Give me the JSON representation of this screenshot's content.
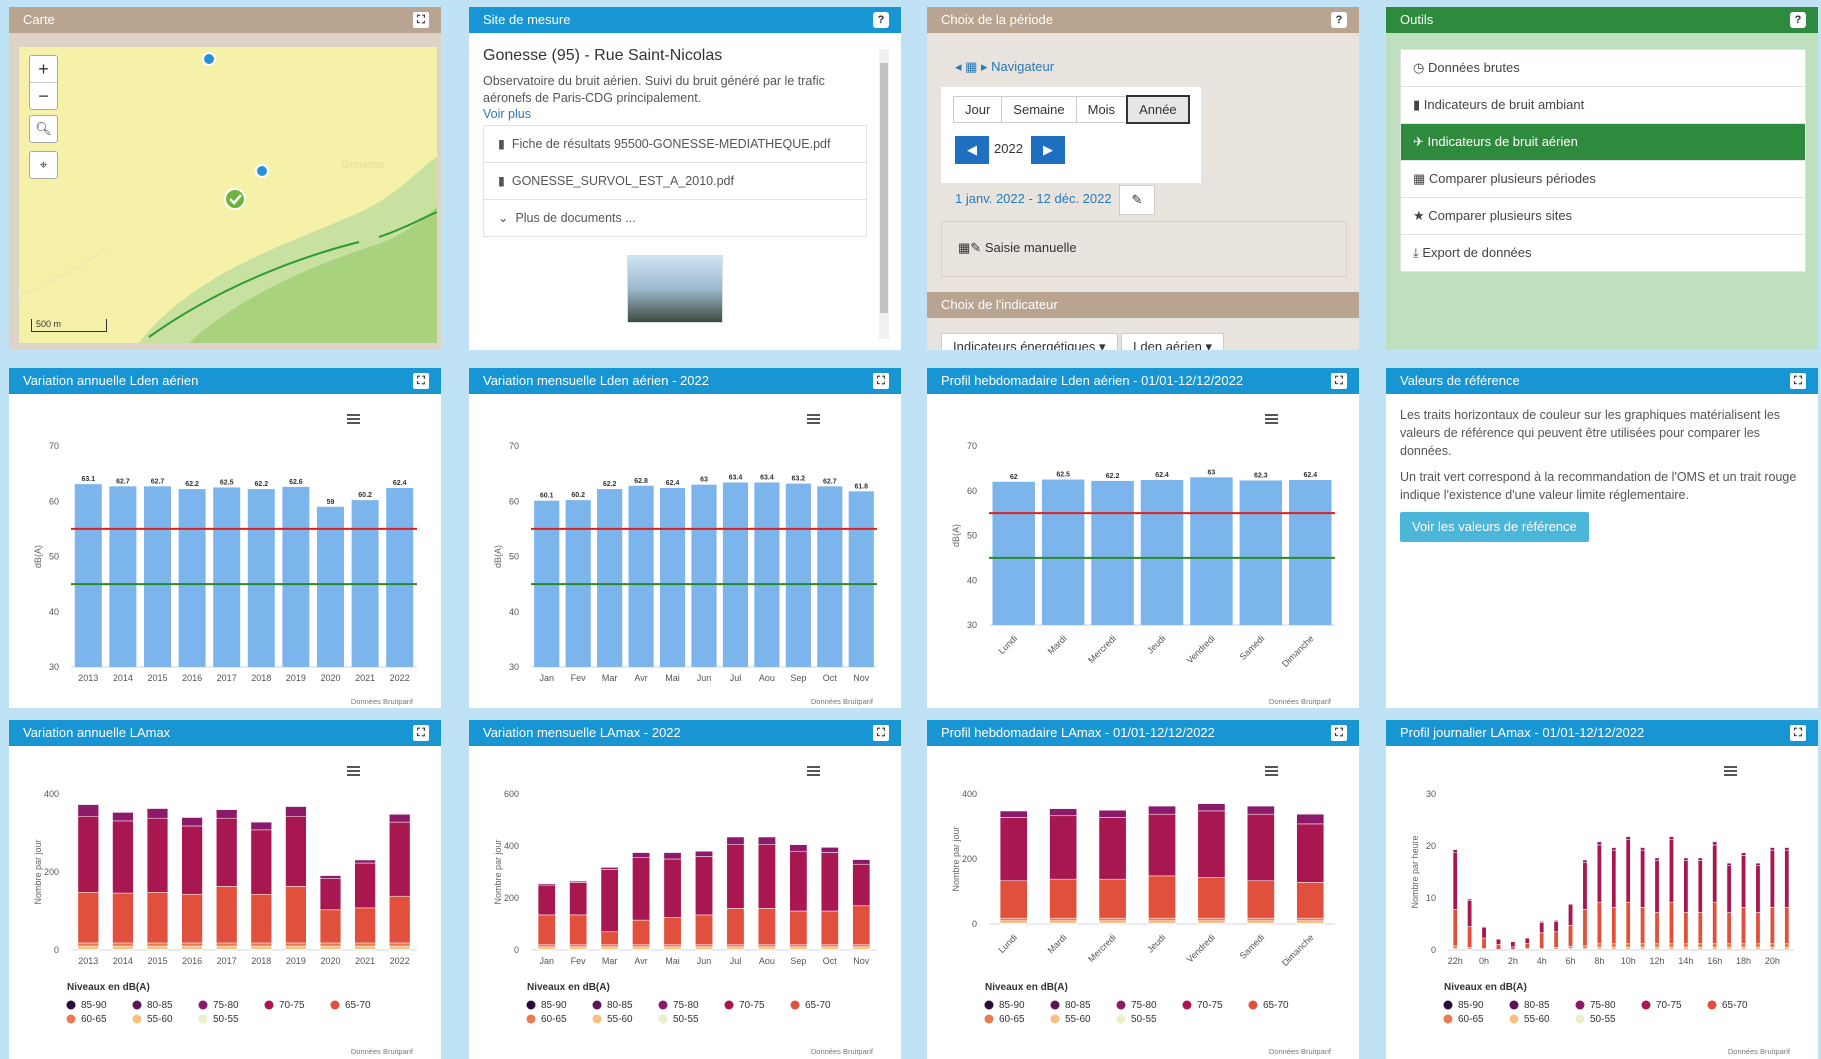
{
  "carte": {
    "title": "Carte",
    "zoom_in": "+",
    "zoom_out": "−",
    "scale": "500 m",
    "place": "Gonesse"
  },
  "site": {
    "title": "Site de mesure",
    "name": "Gonesse (95) - Rue Saint-Nicolas",
    "desc": "Observatoire du bruit aérien. Suivi du bruit généré par le trafic aéronefs de Paris-CDG principalement.",
    "more": "Voir plus",
    "docs": [
      "Fiche de résultats 95500-GONESSE-MEDIATHEQUE.pdf",
      "GONESSE_SURVOL_EST_A_2010.pdf",
      "Plus de documents ..."
    ]
  },
  "periode": {
    "title": "Choix de la période",
    "nav": "Navigateur",
    "tabs": [
      "Jour",
      "Semaine",
      "Mois",
      "Année"
    ],
    "year": "2022",
    "range": "1 janv. 2022 - 12 déc. 2022",
    "manual": "Saisie manuelle"
  },
  "indicateur": {
    "title": "Choix de l'indicateur",
    "d1": "Indicateurs énergétiques",
    "d2": "Lden aérien"
  },
  "outils": {
    "title": "Outils",
    "items": [
      "Données brutes",
      "Indicateurs de bruit ambiant",
      "Indicateurs de bruit aérien",
      "Comparer plusieurs périodes",
      "Comparer plusieurs sites",
      "Export de données"
    ]
  },
  "ref": {
    "title": "Valeurs de référence",
    "p1": "Les traits horizontaux de couleur sur les graphiques matérialisent les valeurs de référence qui peuvent être utilisées pour comparer les données.",
    "p2": "Un trait vert correspond à la recommandation de l'OMS et un trait rouge indique l'existence d'une valeur limite réglementaire.",
    "button": "Voir les valeurs de référence"
  },
  "credit": "Données Bruitparif",
  "legend": {
    "title": "Niveaux en dB(A)",
    "items": [
      "85-90",
      "80-85",
      "75-80",
      "70-75",
      "65-70",
      "60-65",
      "55-60",
      "50-55"
    ],
    "colors": [
      "#2b0a3d",
      "#5b1557",
      "#8c1a6a",
      "#a8174f",
      "#e0503c",
      "#ea7a4f",
      "#f5c17f",
      "#e8f0c8"
    ]
  },
  "chart_data": [
    {
      "id": "c1",
      "title": "Variation annuelle Lden aérien",
      "type": "bar",
      "ylabel": "dB(A)",
      "ylim": [
        30,
        70
      ],
      "yticks": [
        30,
        40,
        50,
        60,
        70
      ],
      "categories": [
        "2013",
        "2014",
        "2015",
        "2016",
        "2017",
        "2018",
        "2019",
        "2020",
        "2021",
        "2022"
      ],
      "values": [
        63.1,
        62.7,
        62.7,
        62.2,
        62.5,
        62.2,
        62.6,
        59,
        60.2,
        62.4
      ],
      "labels": [
        "63.1",
        "62.7",
        "62.7",
        "62.2",
        "62.5",
        "62.2",
        "62.6",
        "59",
        "60.2",
        "62.4"
      ],
      "ref_lines": [
        {
          "value": 55,
          "color": "#e02020"
        },
        {
          "value": 45,
          "color": "#2a8a2a"
        }
      ]
    },
    {
      "id": "c2",
      "title": "Variation mensuelle Lden aérien - 2022",
      "type": "bar",
      "ylabel": "dB(A)",
      "ylim": [
        30,
        70
      ],
      "yticks": [
        30,
        40,
        50,
        60,
        70
      ],
      "categories": [
        "Jan",
        "Fev",
        "Mar",
        "Avr",
        "Mai",
        "Jun",
        "Jul",
        "Aou",
        "Sep",
        "Oct",
        "Nov"
      ],
      "values": [
        60.1,
        60.2,
        62.2,
        62.8,
        62.4,
        63,
        63.4,
        63.4,
        63.2,
        62.7,
        61.8
      ],
      "labels": [
        "60.1",
        "60.2",
        "62.2",
        "62.8",
        "62.4",
        "63",
        "63.4",
        "63.4",
        "63.2",
        "62.7",
        "61.8"
      ],
      "ref_lines": [
        {
          "value": 55,
          "color": "#e02020"
        },
        {
          "value": 45,
          "color": "#2a8a2a"
        }
      ]
    },
    {
      "id": "c3",
      "title": "Profil hebdomadaire Lden aérien - 01/01-12/12/2022",
      "type": "bar",
      "ylabel": "dB(A)",
      "ylim": [
        30,
        70
      ],
      "yticks": [
        30,
        40,
        50,
        60,
        70
      ],
      "categories": [
        "Lundi",
        "Mardi",
        "Mercredi",
        "Jeudi",
        "Vendredi",
        "Samedi",
        "Dimanche"
      ],
      "values": [
        62,
        62.5,
        62.2,
        62.4,
        63,
        62.3,
        62.4
      ],
      "labels": [
        "62",
        "62.5",
        "62.2",
        "62.4",
        "63",
        "62.3",
        "62.4"
      ],
      "ref_lines": [
        {
          "value": 55,
          "color": "#e02020"
        },
        {
          "value": 45,
          "color": "#2a8a2a"
        }
      ]
    },
    {
      "id": "c4",
      "title": "Variation annuelle LAmax",
      "type": "bar",
      "stacked": true,
      "ylabel": "Nombre par jour",
      "ylim": [
        0,
        400
      ],
      "yticks": [
        0,
        200,
        400
      ],
      "categories": [
        "2013",
        "2014",
        "2015",
        "2016",
        "2017",
        "2018",
        "2019",
        "2020",
        "2021",
        "2022"
      ],
      "series": [
        {
          "name": "50-55",
          "values": [
            2,
            2,
            2,
            2,
            2,
            2,
            2,
            2,
            2,
            2
          ]
        },
        {
          "name": "55-60",
          "values": [
            8,
            8,
            8,
            8,
            8,
            8,
            8,
            8,
            8,
            8
          ]
        },
        {
          "name": "60-65",
          "values": [
            8,
            8,
            8,
            8,
            8,
            8,
            8,
            8,
            8,
            8
          ]
        },
        {
          "name": "65-70",
          "values": [
            130,
            128,
            130,
            125,
            145,
            125,
            145,
            85,
            90,
            120
          ]
        },
        {
          "name": "70-75",
          "values": [
            195,
            185,
            190,
            175,
            175,
            165,
            180,
            80,
            115,
            190
          ]
        },
        {
          "name": "75-80",
          "values": [
            30,
            22,
            25,
            22,
            22,
            20,
            25,
            8,
            8,
            20
          ]
        },
        {
          "name": "80-85",
          "values": [
            1,
            1,
            1,
            1,
            1,
            1,
            1,
            1,
            1,
            1
          ]
        },
        {
          "name": "85-90",
          "values": [
            0,
            0,
            0,
            0,
            0,
            0,
            0,
            0,
            0,
            0
          ]
        }
      ]
    },
    {
      "id": "c5",
      "title": "Variation mensuelle LAmax - 2022",
      "type": "bar",
      "stacked": true,
      "ylabel": "Nombre par jour",
      "ylim": [
        0,
        600
      ],
      "yticks": [
        0,
        200,
        400,
        600
      ],
      "categories": [
        "Jan",
        "Fev",
        "Mar",
        "Avr",
        "Mai",
        "Jun",
        "Jul",
        "Aou",
        "Sep",
        "Oct",
        "Nov"
      ],
      "series": [
        {
          "name": "50-55",
          "values": [
            2,
            2,
            2,
            2,
            2,
            2,
            2,
            2,
            2,
            2,
            2
          ]
        },
        {
          "name": "55-60",
          "values": [
            10,
            10,
            10,
            10,
            10,
            10,
            10,
            10,
            10,
            10,
            10
          ]
        },
        {
          "name": "60-65",
          "values": [
            8,
            8,
            8,
            8,
            8,
            8,
            8,
            8,
            8,
            8,
            8
          ]
        },
        {
          "name": "65-70",
          "values": [
            115,
            115,
            50,
            95,
            105,
            115,
            140,
            140,
            130,
            130,
            150
          ]
        },
        {
          "name": "70-75",
          "values": [
            115,
            125,
            240,
            240,
            225,
            225,
            245,
            245,
            230,
            225,
            160
          ]
        },
        {
          "name": "75-80",
          "values": [
            5,
            5,
            8,
            20,
            25,
            20,
            30,
            30,
            25,
            20,
            18
          ]
        },
        {
          "name": "80-85",
          "values": [
            1,
            1,
            1,
            1,
            1,
            1,
            1,
            1,
            1,
            1,
            1
          ]
        },
        {
          "name": "85-90",
          "values": [
            0,
            0,
            0,
            0,
            0,
            0,
            0,
            0,
            0,
            0,
            0
          ]
        }
      ]
    },
    {
      "id": "c6",
      "title": "Profil hebdomadaire LAmax - 01/01-12/12/2022",
      "type": "bar",
      "stacked": true,
      "ylabel": "Nombre par jour",
      "ylim": [
        0,
        400
      ],
      "yticks": [
        0,
        200,
        400
      ],
      "categories": [
        "Lundi",
        "Mardi",
        "Mercredi",
        "Jeudi",
        "Vendredi",
        "Samedi",
        "Dimanche"
      ],
      "series": [
        {
          "name": "50-55",
          "values": [
            2,
            2,
            2,
            2,
            2,
            2,
            2
          ]
        },
        {
          "name": "55-60",
          "values": [
            8,
            8,
            8,
            8,
            8,
            8,
            8
          ]
        },
        {
          "name": "60-65",
          "values": [
            8,
            8,
            8,
            8,
            8,
            8,
            8
          ]
        },
        {
          "name": "65-70",
          "values": [
            115,
            120,
            120,
            130,
            125,
            115,
            110
          ]
        },
        {
          "name": "70-75",
          "values": [
            195,
            195,
            190,
            190,
            205,
            205,
            180
          ]
        },
        {
          "name": "75-80",
          "values": [
            20,
            22,
            22,
            25,
            22,
            25,
            30
          ]
        },
        {
          "name": "80-85",
          "values": [
            1,
            1,
            1,
            1,
            1,
            1,
            1
          ]
        },
        {
          "name": "85-90",
          "values": [
            0,
            0,
            0,
            0,
            0,
            0,
            0
          ]
        }
      ]
    },
    {
      "id": "c7",
      "title": "Profil journalier LAmax - 01/01-12/12/2022",
      "type": "bar",
      "stacked": true,
      "ylabel": "Nombre par heure",
      "ylim": [
        0,
        30
      ],
      "yticks": [
        0,
        10,
        20,
        30
      ],
      "categories": [
        "22h",
        "23h",
        "0h",
        "1h",
        "2h",
        "3h",
        "4h",
        "5h",
        "6h",
        "7h",
        "8h",
        "9h",
        "10h",
        "11h",
        "12h",
        "13h",
        "14h",
        "15h",
        "16h",
        "17h",
        "18h",
        "19h",
        "20h",
        "21h"
      ],
      "xticks": [
        "22h",
        "0h",
        "2h",
        "4h",
        "6h",
        "8h",
        "10h",
        "12h",
        "14h",
        "16h",
        "18h",
        "20h"
      ],
      "series": [
        {
          "name": "50-55",
          "values": [
            0,
            0,
            0,
            0,
            0,
            0,
            0,
            0,
            0,
            0,
            0,
            0,
            0,
            0,
            0,
            0,
            0,
            0,
            0,
            0,
            0,
            0,
            0,
            0
          ]
        },
        {
          "name": "55-60",
          "values": [
            0.3,
            0.2,
            0.1,
            0,
            0,
            0.1,
            0.1,
            0.2,
            0.3,
            0.3,
            0.5,
            0.5,
            0.5,
            0.5,
            0.5,
            0.5,
            0.5,
            0.5,
            0.5,
            0.5,
            0.5,
            0.5,
            0.5,
            0.5
          ]
        },
        {
          "name": "60-65",
          "values": [
            0.5,
            0.3,
            0.2,
            0.1,
            0.1,
            0.2,
            0.2,
            0.3,
            0.4,
            0.5,
            0.7,
            0.7,
            0.7,
            0.7,
            0.7,
            0.7,
            0.7,
            0.7,
            0.7,
            0.7,
            0.7,
            0.7,
            0.7,
            0.7
          ]
        },
        {
          "name": "65-70",
          "values": [
            7,
            4,
            2,
            1,
            0.5,
            1,
            3,
            3,
            4,
            7,
            8,
            7,
            8,
            7,
            6,
            8,
            6,
            6,
            8,
            6,
            7,
            6,
            7,
            7
          ]
        },
        {
          "name": "70-75",
          "values": [
            11,
            5,
            2,
            1,
            1,
            1,
            2,
            2,
            4,
            9,
            11,
            11,
            12,
            11,
            10,
            12,
            10,
            10,
            11,
            9,
            10,
            9,
            11,
            11
          ]
        },
        {
          "name": "75-80",
          "values": [
            0.5,
            0.3,
            0.2,
            0.1,
            0.1,
            0.1,
            0.2,
            0.2,
            0.2,
            0.5,
            0.6,
            0.5,
            0.6,
            0.5,
            0.5,
            0.6,
            0.5,
            0.5,
            0.6,
            0.5,
            0.5,
            0.5,
            0.5,
            0.5
          ]
        },
        {
          "name": "80-85",
          "values": [
            0,
            0,
            0,
            0,
            0,
            0,
            0,
            0,
            0,
            0,
            0,
            0,
            0,
            0,
            0,
            0,
            0,
            0,
            0,
            0,
            0,
            0,
            0,
            0
          ]
        },
        {
          "name": "85-90",
          "values": [
            0,
            0,
            0,
            0,
            0,
            0,
            0,
            0,
            0,
            0,
            0,
            0,
            0,
            0,
            0,
            0,
            0,
            0,
            0,
            0,
            0,
            0,
            0,
            0
          ]
        }
      ]
    }
  ]
}
